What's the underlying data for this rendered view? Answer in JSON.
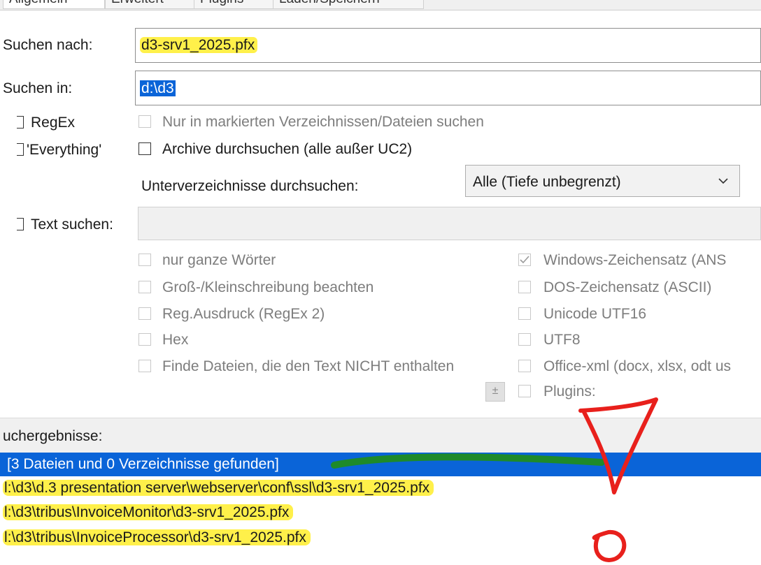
{
  "tabs": [
    "Allgemein",
    "Erweitert",
    "Plugins",
    "Laden/Speichern"
  ],
  "search_for": {
    "label": "Suchen nach:",
    "value": "d3-srv1_2025.pfx"
  },
  "search_in": {
    "label": "Suchen in:",
    "value": "d:\\d3"
  },
  "options": {
    "regex": "RegEx",
    "everything": "'Everything'",
    "only_marked": "Nur in markierten Verzeichnissen/Dateien suchen",
    "archives": "Archive durchsuchen (alle außer UC2)",
    "subdirs_label": "Unterverzeichnisse durchsuchen:",
    "subdirs_value": "Alle (Tiefe unbegrenzt)"
  },
  "text_search": {
    "label": "Text suchen:",
    "left_options": [
      "nur ganze Wörter",
      "Groß-/Kleinschreibung beachten",
      "Reg.Ausdruck (RegEx 2)",
      "Hex",
      "Finde Dateien, die den Text NICHT enthalten"
    ],
    "right_options": [
      "Windows-Zeichensatz (ANS",
      "DOS-Zeichensatz (ASCII)",
      "Unicode UTF16",
      "UTF8",
      "Office-xml (docx, xlsx, odt us",
      "Plugins:"
    ],
    "plus_button": "±"
  },
  "results": {
    "label": "uchergebnisse:",
    "rows": [
      "[3 Dateien und 0 Verzeichnisse gefunden]",
      "l:\\d3\\d.3 presentation server\\webserver\\conf\\ssl\\d3-srv1_2025.pfx",
      "l:\\d3\\tribus\\InvoiceMonitor\\d3-srv1_2025.pfx",
      "l:\\d3\\tribus\\InvoiceProcessor\\d3-srv1_2025.pfx"
    ]
  },
  "colors": {
    "highlight_yellow": "#fff04a",
    "selection_blue": "#0a64d8",
    "annotation_red": "#e8201c",
    "annotation_green": "#1e8a2a"
  }
}
